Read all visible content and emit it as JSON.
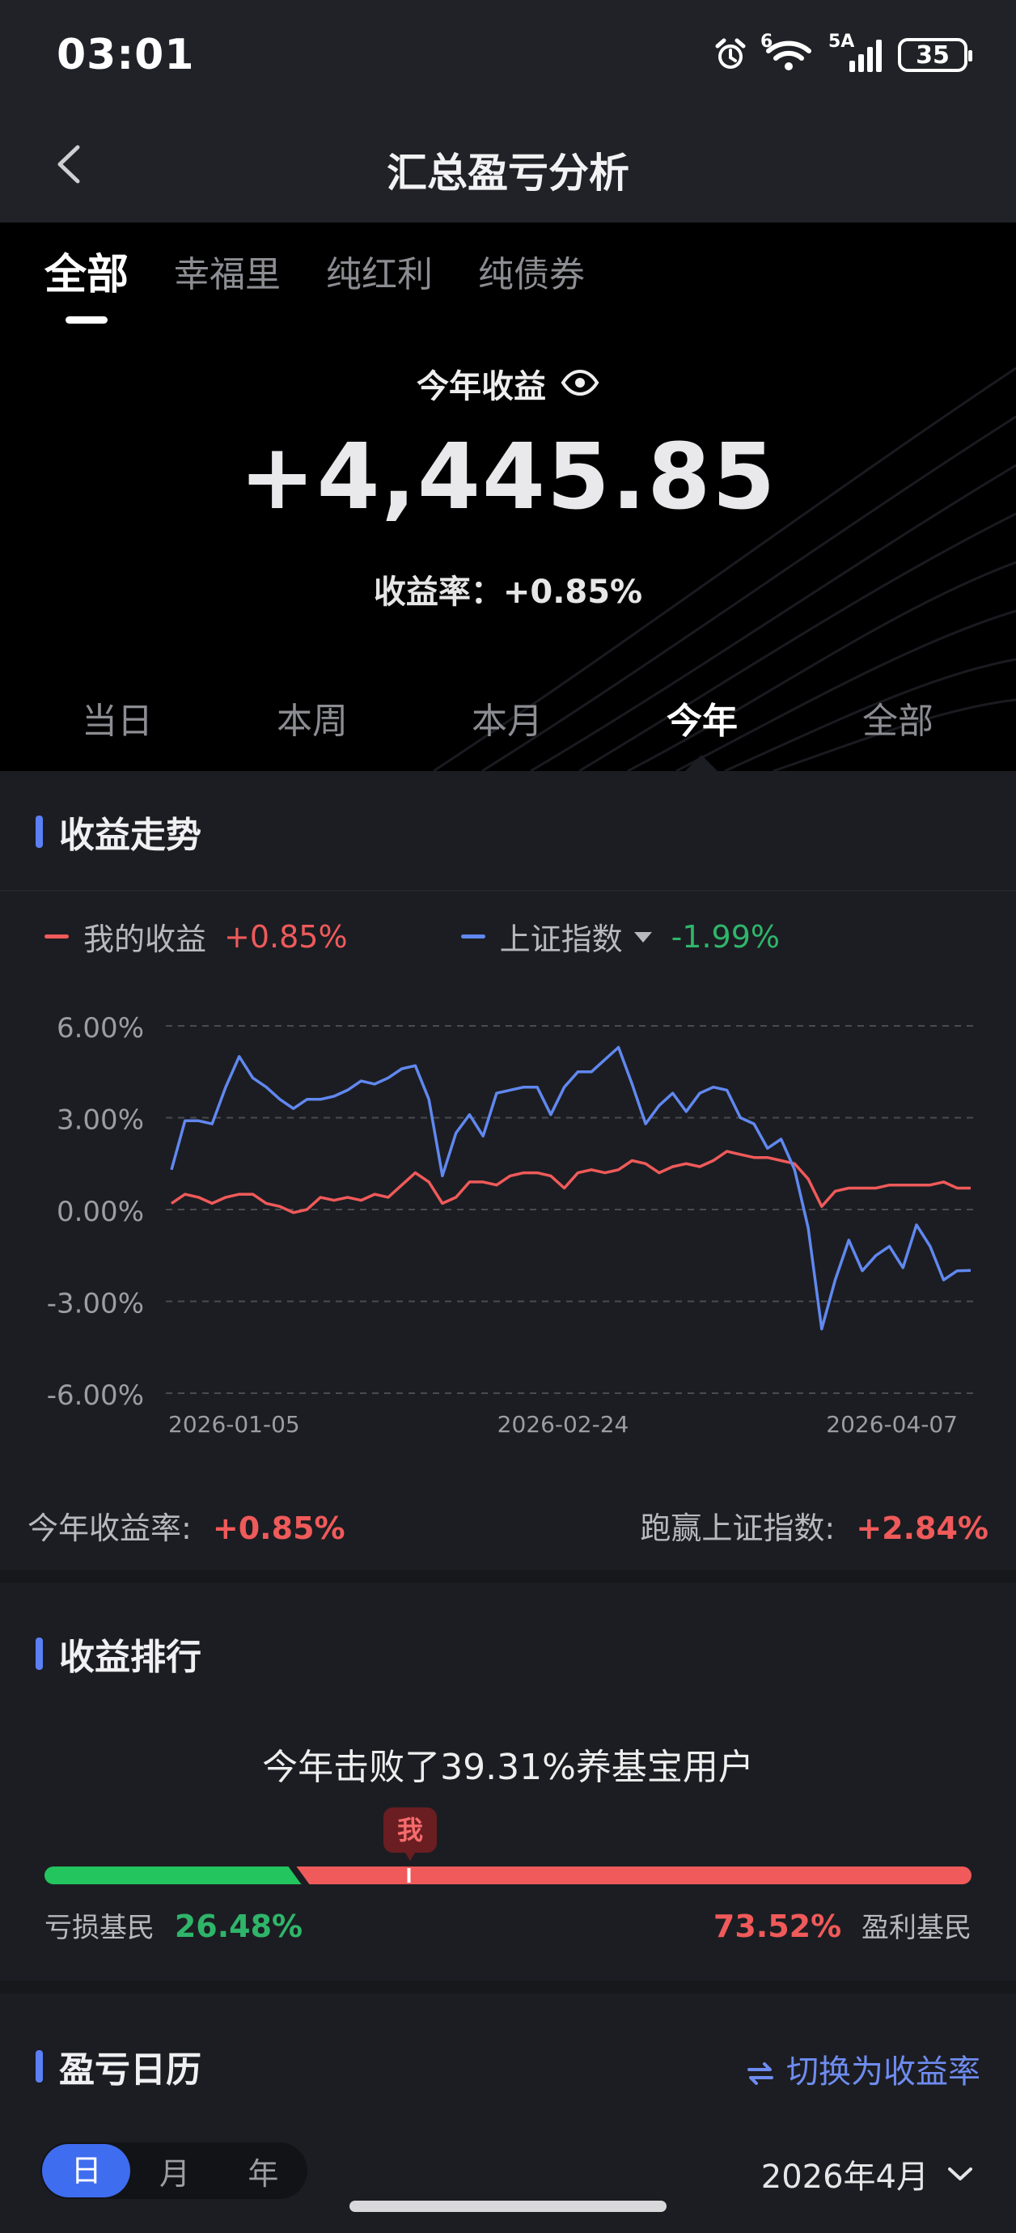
{
  "status_bar": {
    "time": "03:01",
    "signal_labels": [
      "6",
      "5A"
    ],
    "battery": "35",
    "icons": [
      "alarm-icon",
      "wifi-icon",
      "signal-icon",
      "battery-icon"
    ]
  },
  "nav": {
    "title": "汇总盈亏分析",
    "back_icon": "chevron-left-icon"
  },
  "fund_tabs": [
    {
      "label": "全部",
      "active": true
    },
    {
      "label": "幸福里",
      "active": false
    },
    {
      "label": "纯红利",
      "active": false
    },
    {
      "label": "纯债券",
      "active": false
    }
  ],
  "hero": {
    "label": "今年收益",
    "amount": "+4,445.85",
    "rate_label": "收益率：",
    "rate_value": "+0.85%"
  },
  "period_tabs": [
    {
      "label": "当日",
      "active": false
    },
    {
      "label": "本周",
      "active": false
    },
    {
      "label": "本月",
      "active": false
    },
    {
      "label": "今年",
      "active": true
    },
    {
      "label": "全部",
      "active": false
    }
  ],
  "trend": {
    "section_title": "收益走势",
    "legend_mine_label": "我的收益",
    "legend_mine_value": "+0.85%",
    "legend_index_label": "上证指数",
    "legend_index_value": "-1.99%",
    "ytick_labels": [
      "6.00%",
      "3.00%",
      "0.00%",
      "-3.00%",
      "-6.00%"
    ],
    "xtick_labels": [
      "2026-01-05",
      "2026-02-24",
      "2026-04-07"
    ],
    "ytd_label": "今年收益率:",
    "ytd_value": "+0.85%",
    "beat_label": "跑赢上证指数:",
    "beat_value": "+2.84%"
  },
  "chart_data": {
    "type": "line",
    "ylim": [
      -6,
      6
    ],
    "yticks": [
      6,
      3,
      0,
      -3,
      -6
    ],
    "xtick_labels": [
      "2026-01-05",
      "2026-02-24",
      "2026-04-07"
    ],
    "series": [
      {
        "name": "我的收益",
        "color": "#f05a5a",
        "values": [
          0.2,
          0.5,
          0.4,
          0.2,
          0.4,
          0.5,
          0.5,
          0.2,
          0.1,
          -0.1,
          0.0,
          0.4,
          0.3,
          0.4,
          0.3,
          0.5,
          0.4,
          0.8,
          1.2,
          0.9,
          0.2,
          0.4,
          0.9,
          0.9,
          0.8,
          1.1,
          1.2,
          1.2,
          1.1,
          0.7,
          1.2,
          1.3,
          1.2,
          1.3,
          1.6,
          1.5,
          1.2,
          1.4,
          1.5,
          1.4,
          1.6,
          1.9,
          1.8,
          1.7,
          1.7,
          1.6,
          1.5,
          1.0,
          0.1,
          0.6,
          0.7,
          0.7,
          0.7,
          0.8,
          0.8,
          0.8,
          0.8,
          0.9,
          0.7,
          0.7
        ]
      },
      {
        "name": "上证指数",
        "color": "#6088f0",
        "values": [
          1.3,
          2.9,
          2.9,
          2.8,
          4.0,
          5.0,
          4.3,
          4.0,
          3.6,
          3.3,
          3.6,
          3.6,
          3.7,
          3.9,
          4.2,
          4.1,
          4.3,
          4.6,
          4.7,
          3.6,
          1.1,
          2.5,
          3.1,
          2.4,
          3.8,
          3.9,
          4.0,
          4.0,
          3.1,
          4.0,
          4.5,
          4.5,
          4.9,
          5.3,
          4.1,
          2.8,
          3.4,
          3.8,
          3.2,
          3.8,
          4.0,
          3.9,
          3.0,
          2.8,
          2.0,
          2.3,
          1.3,
          -0.6,
          -3.9,
          -2.3,
          -1.0,
          -2.0,
          -1.5,
          -1.2,
          -1.9,
          -0.5,
          -1.2,
          -2.3,
          -2.0,
          -1.99
        ]
      }
    ]
  },
  "ranking": {
    "section_title": "收益排行",
    "headline": "今年击败了39.31%养基宝用户",
    "me_label": "我",
    "loss_label": "亏损基民",
    "loss_value": "26.48%",
    "profit_value": "73.52%",
    "profit_label": "盈利基民",
    "loss_share": 0.2648,
    "beat_share": 0.3931,
    "loss_color": "#22c55e",
    "profit_color": "#f05a5a"
  },
  "calendar": {
    "section_title": "盈亏日历",
    "switch_label": "切换为收益率",
    "seg": [
      "日",
      "月",
      "年"
    ],
    "month": "2026年4月"
  },
  "accent": "#5b7ff5"
}
